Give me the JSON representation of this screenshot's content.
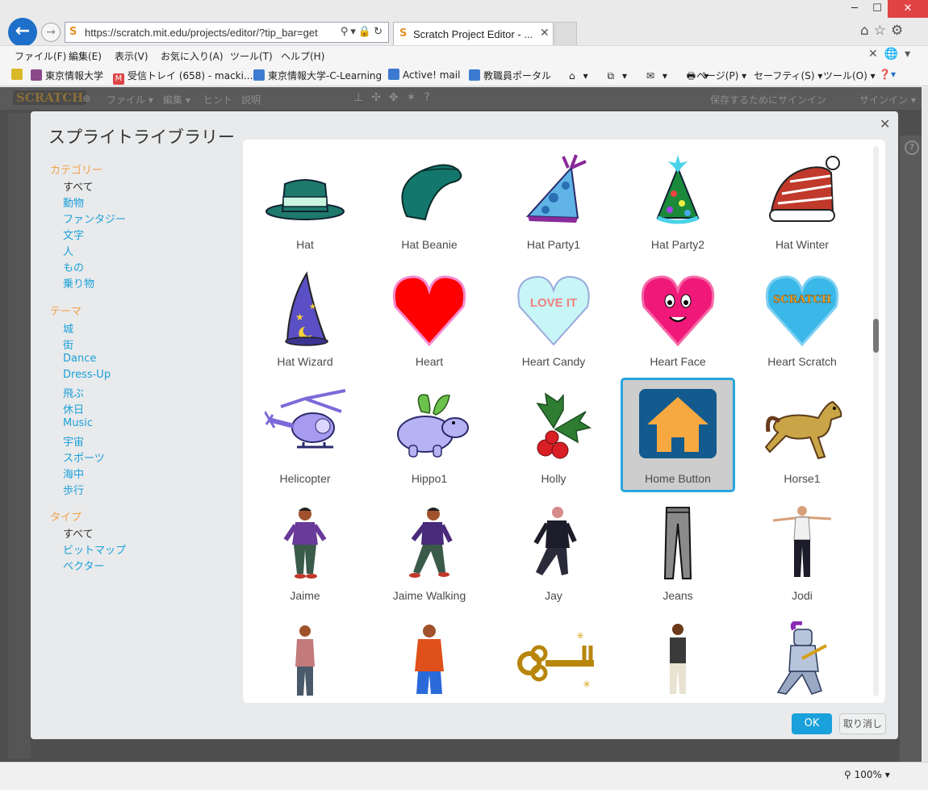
{
  "browser": {
    "url": "https://scratch.mit.edu/projects/editor/?tip_bar=get",
    "tab_title": "Scratch Project Editor - ...",
    "zoom": "100%",
    "menu": [
      "ファイル(F)",
      "編集(E)",
      "表示(V)",
      "お気に入り(A)",
      "ツール(T)",
      "ヘルプ(H)"
    ],
    "favorites": [
      "東京情報大学",
      "受信トレイ (658) - macki...",
      "東京情報大学-C-Learning",
      "Active! mail",
      "教職員ポータル"
    ],
    "commands": [
      "ページ(P) ▾",
      "セーフティ(S) ▾",
      "ツール(O) ▾"
    ]
  },
  "scratch": {
    "logo": "SCRATCH",
    "menu": [
      "ファイル ▾",
      "編集 ▾",
      "ヒント",
      "説明"
    ],
    "signin_prompt": "保存するためにサインイン",
    "signin": "サインイン ▾"
  },
  "library": {
    "title": "スプライトライブラリー",
    "category_header": "カテゴリー",
    "categories": [
      "すべて",
      "動物",
      "ファンタジー",
      "文字",
      "人",
      "もの",
      "乗り物"
    ],
    "theme_header": "テーマ",
    "themes": [
      "城",
      "街",
      "Dance",
      "Dress-Up",
      "飛ぶ",
      "休日",
      "Music",
      "宇宙",
      "スポーツ",
      "海中",
      "歩行"
    ],
    "type_header": "タイプ",
    "types": [
      "すべて",
      "ビットマップ",
      "ベクター"
    ],
    "sprites": [
      "Hat",
      "Hat Beanie",
      "Hat Party1",
      "Hat Party2",
      "Hat Winter",
      "Hat Wizard",
      "Heart",
      "Heart Candy",
      "Heart Face",
      "Heart Scratch",
      "Helicopter",
      "Hippo1",
      "Holly",
      "Home Button",
      "Horse1",
      "Jaime",
      "Jaime Walking",
      "Jay",
      "Jeans",
      "Jodi",
      "",
      "",
      "",
      "",
      ""
    ],
    "selected_sprite": "Home Button",
    "heart_candy_text": "LOVE IT",
    "heart_scratch_text": "SCRATCH",
    "ok": "OK",
    "cancel": "取り消し"
  }
}
